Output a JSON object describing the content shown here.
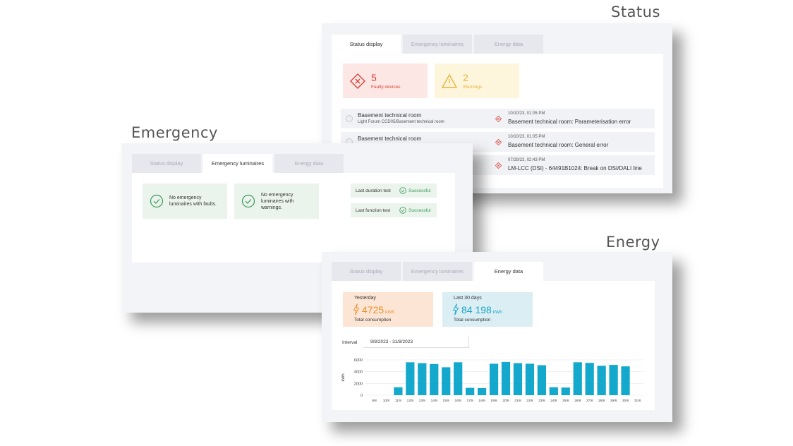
{
  "captions": {
    "status": "Status",
    "emergency": "Emergency",
    "energy": "Energy"
  },
  "tabs": [
    "Status display",
    "Emergency luminaires",
    "Energy data"
  ],
  "status": {
    "faulty": {
      "count": "5",
      "label": "Faulty devices",
      "icon": "diamond-x-icon",
      "color": "#d9433b",
      "bg": "#fde7e4"
    },
    "warnings": {
      "count": "2",
      "label": "Warnings",
      "icon": "warning-triangle-icon",
      "color": "#e9b23a",
      "bg": "#fdf6dc"
    },
    "rows": [
      {
        "title": "Basement technical room",
        "subtitle": "Light Forum CCD05/Basement technical room",
        "time": "10/10/23, 01:05 PM",
        "message": "Basement technical room: Parameterisation error"
      },
      {
        "title": "Basement technical room",
        "subtitle": "",
        "time": "10/10/23, 01:05 PM",
        "message": "Basement technical room: General error"
      },
      {
        "title": "",
        "subtitle": "",
        "time": "07/28/23, 02:43 PM",
        "message": "LM-LCC (DSI) - 64491B1024: Break on DSI/DALI line"
      }
    ]
  },
  "emergency": {
    "cards": [
      {
        "text": "No emergency luminaires with faults.",
        "icon": "check-circle-icon"
      },
      {
        "text": "No emergency luminaires with warnings.",
        "icon": "check-circle-icon"
      }
    ],
    "tests": [
      {
        "label": "Last duration test",
        "result": "Successful"
      },
      {
        "label": "Last function test",
        "result": "Successful"
      }
    ],
    "accent": "#3a9a5b"
  },
  "energy": {
    "yesterday": {
      "label": "Yesterday",
      "value": "4725",
      "unit": "kWh",
      "sub": "Total consumption",
      "color": "#e8912d",
      "bg": "#fce5d4"
    },
    "last30": {
      "label": "Last 30 days",
      "value": "84 198",
      "unit": "kWh",
      "sub": "Total consumption",
      "color": "#1ba5c7",
      "bg": "#daeef4"
    },
    "interval": {
      "label": "Interval",
      "value": "9/8/2023 - 31/8/2023"
    }
  },
  "chart_data": {
    "type": "bar",
    "ylabel": "kWh",
    "ylim": [
      0,
      6000
    ],
    "yticks": [
      "6000",
      "4000",
      "2000",
      "0"
    ],
    "color": "#13a8cc",
    "categories": [
      "9/8",
      "10/8",
      "11/8",
      "12/8",
      "13/8",
      "14/8",
      "15/8",
      "16/8",
      "17/8",
      "18/8",
      "19/8",
      "20/8",
      "21/8",
      "22/8",
      "23/8",
      "24/8",
      "25/8",
      "26/8",
      "27/8",
      "28/8",
      "29/8",
      "30/8",
      "31/8"
    ],
    "values": [
      0,
      0,
      1350,
      5600,
      5450,
      5300,
      4750,
      5600,
      1250,
      1200,
      5350,
      5650,
      5450,
      5350,
      5100,
      1350,
      1300,
      5600,
      5500,
      5000,
      5150,
      4900,
      0
    ]
  }
}
